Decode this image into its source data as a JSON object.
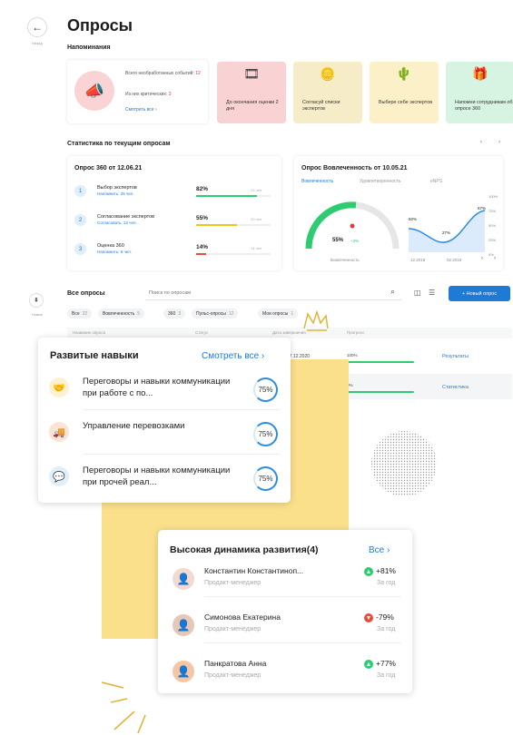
{
  "header": {
    "back_label": "Назад",
    "title": "Опросы"
  },
  "reminders": {
    "title": "Напоминания",
    "summary": {
      "total_label": "Всего необработанных событий:",
      "total_value": "12",
      "critical_label": "Из них критических:",
      "critical_value": "3",
      "see_all": "Смотреть все"
    },
    "tiles": [
      {
        "text": "До окончания оценки 2 дня",
        "color": "#f9d3d3"
      },
      {
        "text": "Согласуй списки экспертов",
        "color": "#f7ecc8"
      },
      {
        "text": "Выбере себе экспертов",
        "color": "#fcf0c8"
      },
      {
        "text": "Напомни сотрудникам об опросе 360",
        "color": "#d7f3e2"
      }
    ]
  },
  "stats": {
    "title": "Статистика по текущим опросам",
    "survey360": {
      "title": "Опрос 360 от 12.06.21",
      "rows": [
        {
          "num": "1",
          "name": "Выбор экспертов",
          "sub": "Напомнить: 25 чел.",
          "pct": "82%",
          "count": "22 чел.",
          "fill": 0.82,
          "color": "#2ecc71"
        },
        {
          "num": "2",
          "name": "Согласование экспертов",
          "sub": "Согласовать: 13 чел.",
          "pct": "55%",
          "count": "20 чел.",
          "fill": 0.55,
          "color": "#f1c40f"
        },
        {
          "num": "3",
          "name": "Оценка 360",
          "sub": "Напомнить: 6 чел.",
          "pct": "14%",
          "count": "14 чел.",
          "fill": 0.14,
          "color": "#e74c3c"
        }
      ]
    },
    "engagement": {
      "title": "Опрос Вовлеченность от 10.05.21",
      "tabs": [
        "Вовлеченность",
        "Удовлетворенность",
        "eNPS"
      ],
      "gauge_value": "55%",
      "gauge_delta": "+3%",
      "gauge_label": "Вовлеченность",
      "chart_y": [
        "100%",
        "75%",
        "50%",
        "25%",
        "0%"
      ],
      "chart_x": [
        "12.2018",
        "02.2019"
      ],
      "points": [
        {
          "label": "50%"
        },
        {
          "label": "27%"
        },
        {
          "label": "67%"
        }
      ]
    }
  },
  "all": {
    "title": "Все опросы",
    "search_placeholder": "Поиск по опросам",
    "new_button": "Новый опрос",
    "fixed_label": "Новые",
    "chips": [
      {
        "label": "Все",
        "count": "32"
      },
      {
        "label": "Вовлеченность",
        "count": "5"
      },
      {
        "label": "360",
        "count": "3"
      },
      {
        "label": "Пульс-опросы",
        "count": "12"
      },
      {
        "label": "Мои опросы",
        "count": "1"
      }
    ],
    "columns": [
      "Название опроса",
      "Статус",
      "Дата завершения",
      "Прогресс"
    ],
    "rows": [
      {
        "date": "17.12.2020",
        "progress": "100%",
        "action": "Результаты"
      },
      {
        "date": "",
        "progress": "0%",
        "action": "Статистика"
      }
    ]
  },
  "skills": {
    "title": "Развитые навыки",
    "see_all": "Смотреть все",
    "items": [
      {
        "text": "Переговоры и навыки коммуникации при работе с по...",
        "pct": "75%",
        "icon": "handshake-icon"
      },
      {
        "text": "Управление перевозками",
        "pct": "75%",
        "icon": "truck-icon"
      },
      {
        "text": "Переговоры и навыки коммуникации при прочей реал...",
        "pct": "75%",
        "icon": "chat-icon"
      }
    ]
  },
  "dynamics": {
    "title": "Высокая динамика развития(4)",
    "all": "Все",
    "people": [
      {
        "name": "Константин Константиноп...",
        "role": "Продакт-менеджер",
        "delta": "+81%",
        "period": "За год",
        "up": true
      },
      {
        "name": "Симонова Екатерина",
        "role": "Продакт-менеджер",
        "delta": "-79%",
        "period": "За год",
        "up": false
      },
      {
        "name": "Панкратова Анна",
        "role": "Продакт-менеджер",
        "delta": "+77%",
        "period": "За год",
        "up": true
      }
    ]
  }
}
